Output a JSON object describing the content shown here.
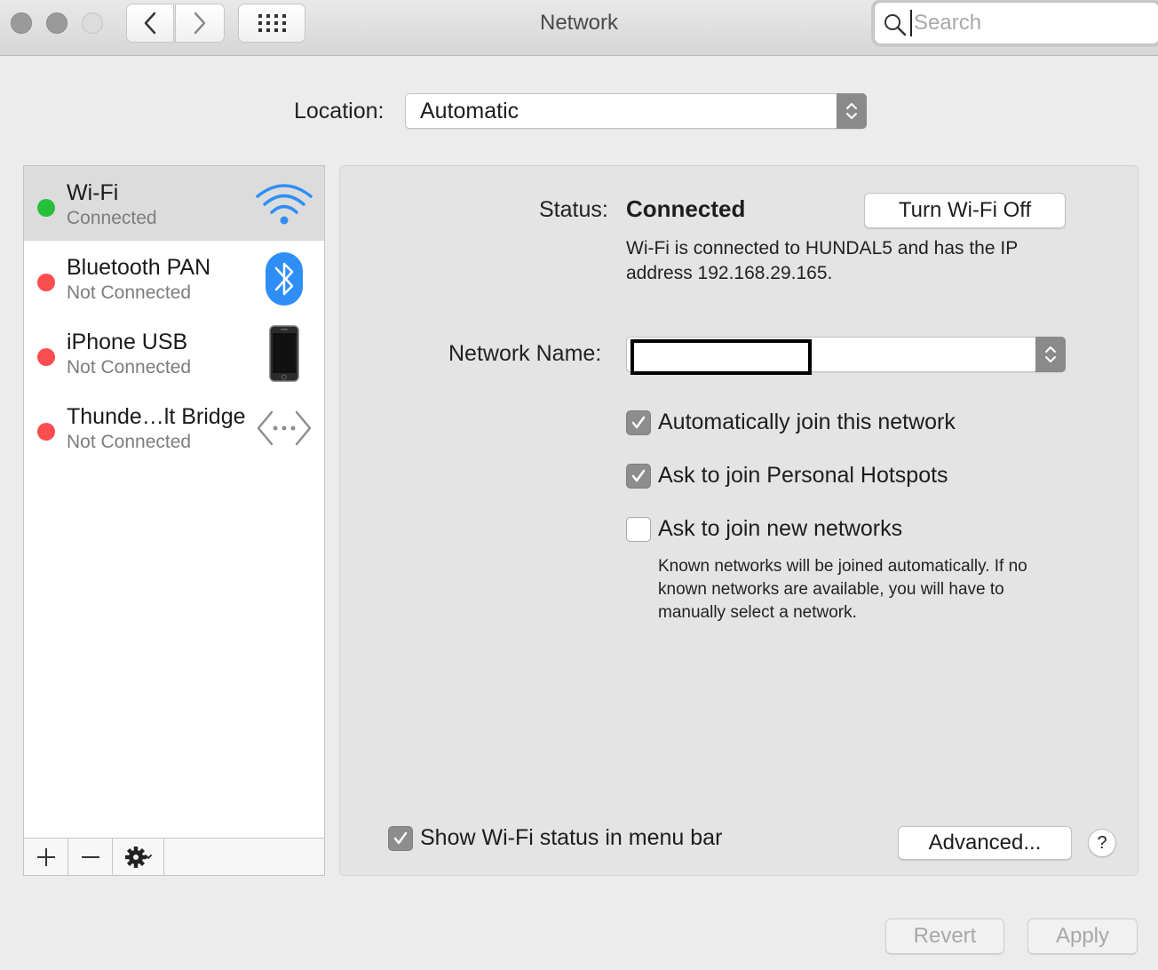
{
  "window": {
    "title": "Network",
    "search_placeholder": "Search"
  },
  "location": {
    "label": "Location:",
    "value": "Automatic"
  },
  "services": [
    {
      "name": "Wi-Fi",
      "status": "Connected",
      "status_color": "#27c03b",
      "icon": "wifi-icon",
      "selected": true
    },
    {
      "name": "Bluetooth PAN",
      "status": "Not Connected",
      "status_color": "#fc4d4f",
      "icon": "bluetooth-icon",
      "selected": false
    },
    {
      "name": "iPhone USB",
      "status": "Not Connected",
      "status_color": "#fc4d4f",
      "icon": "iphone-icon",
      "selected": false
    },
    {
      "name": "Thunde…lt Bridge",
      "status": "Not Connected",
      "status_color": "#fc4d4f",
      "icon": "thunderbolt-bridge-icon",
      "selected": false
    }
  ],
  "sidebar_tools": {
    "add": "+",
    "remove": "—"
  },
  "detail": {
    "status_label": "Status:",
    "status_value": "Connected",
    "turn_off_button": "Turn Wi-Fi Off",
    "status_description": "Wi-Fi is connected to HUNDAL5 and has the IP address 192.168.29.165.",
    "network_name_label": "Network Name:",
    "network_name_value": "",
    "auto_join": {
      "label": "Automatically join this network",
      "checked": true
    },
    "personal_hotspots": {
      "label": "Ask to join Personal Hotspots",
      "checked": true
    },
    "new_networks": {
      "label": "Ask to join new networks",
      "checked": false
    },
    "known_networks_note": "Known networks will be joined automatically. If no known networks are available, you will have to manually select a network.",
    "show_status": {
      "label": "Show Wi-Fi status in menu bar",
      "checked": true
    },
    "advanced_button": "Advanced...",
    "help_button": "?"
  },
  "footer": {
    "revert_button": "Revert",
    "apply_button": "Apply"
  },
  "colors": {
    "accent_blue": "#2e8ef5",
    "connected_green": "#27c03b",
    "disconnected_red": "#fc4d4f"
  }
}
